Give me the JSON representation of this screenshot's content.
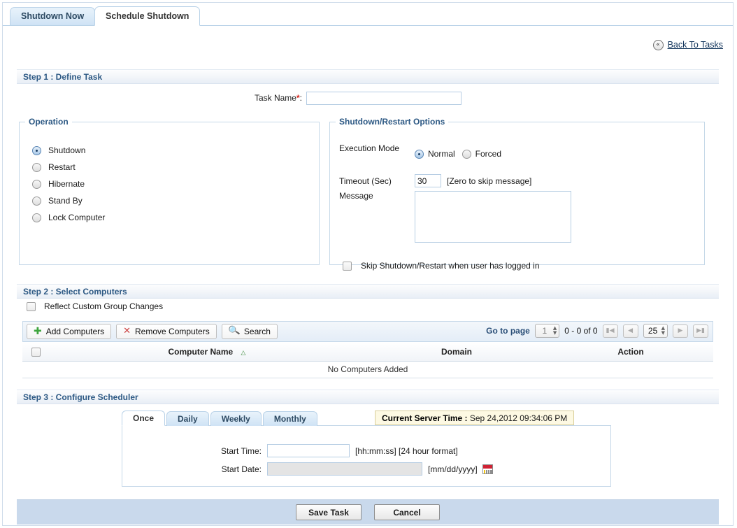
{
  "tabs": [
    {
      "label": "Shutdown Now",
      "active": false
    },
    {
      "label": "Schedule Shutdown",
      "active": true
    }
  ],
  "back": {
    "icon": "double-chevron-left-icon",
    "label": "Back To Tasks"
  },
  "step1": {
    "header": "Step 1 : Define Task",
    "task_name_label": "Task Name",
    "required_marker": "*",
    "task_name_colon": ":",
    "task_name_value": "",
    "operation": {
      "legend": "Operation",
      "selected": "Shutdown",
      "items": [
        {
          "label": "Shutdown",
          "selected": true
        },
        {
          "label": "Restart",
          "selected": false
        },
        {
          "label": "Hibernate",
          "selected": false
        },
        {
          "label": "Stand By",
          "selected": false
        },
        {
          "label": "Lock Computer",
          "selected": false
        }
      ]
    },
    "options": {
      "legend": "Shutdown/Restart Options",
      "execution_mode_label": "Execution Mode",
      "modes": [
        {
          "label": "Normal",
          "selected": true
        },
        {
          "label": "Forced",
          "selected": false
        }
      ],
      "timeout_label": "Timeout (Sec)",
      "timeout_value": "30",
      "timeout_hint": "[Zero to skip message]",
      "message_label": "Message",
      "message_value": "",
      "skip_label": "Skip Shutdown/Restart when user has logged in",
      "skip_checked": false
    }
  },
  "step2": {
    "header": "Step 2 : Select Computers",
    "reflect_label": "Reflect Custom Group Changes",
    "reflect_checked": false,
    "toolbar": [
      {
        "label": "Add Computers",
        "icon": "plus-icon"
      },
      {
        "label": "Remove Computers",
        "icon": "cross-icon"
      },
      {
        "label": "Search",
        "icon": "magnifier-icon"
      }
    ],
    "pager": {
      "goto_label": "Go to page",
      "page_value": "1",
      "range_text": "0 - 0 of 0",
      "page_size": "25",
      "first_icon": "first-page-icon",
      "prev_icon": "prev-page-icon",
      "next_icon": "next-page-icon",
      "last_icon": "last-page-icon"
    },
    "table": {
      "columns": [
        "Computer Name",
        "Domain",
        "Action"
      ],
      "sort_column": "Computer Name",
      "sort_direction": "ascending",
      "empty_text": "No Computers Added",
      "rows": []
    }
  },
  "step3": {
    "header": "Step 3 : Configure Scheduler",
    "sub_tabs": [
      {
        "label": "Once",
        "active": true
      },
      {
        "label": "Daily",
        "active": false
      },
      {
        "label": "Weekly",
        "active": false
      },
      {
        "label": "Monthly",
        "active": false
      }
    ],
    "server_time_label": "Current Server Time :",
    "server_time_value": "Sep 24,2012 09:34:06 PM",
    "start_time_label": "Start Time:",
    "start_time_value": "",
    "start_time_format": "[hh:mm:ss] [24 hour format]",
    "start_date_label": "Start Date:",
    "start_date_value": "",
    "start_date_format": "[mm/dd/yyyy]",
    "calendar_icon": "calendar-icon"
  },
  "footer": {
    "save_label": "Save Task",
    "cancel_label": "Cancel"
  },
  "colors": {
    "accent": "#2d5984",
    "tab_active_bg": "#ffffff",
    "tab_inactive_bg": "#d6e7f6",
    "footer_bg": "#c9d9ec",
    "required_star": "#d4251c",
    "server_time_bg": "#fdf9e3",
    "add_icon": "#3ea53e",
    "remove_icon": "#cc4444"
  }
}
